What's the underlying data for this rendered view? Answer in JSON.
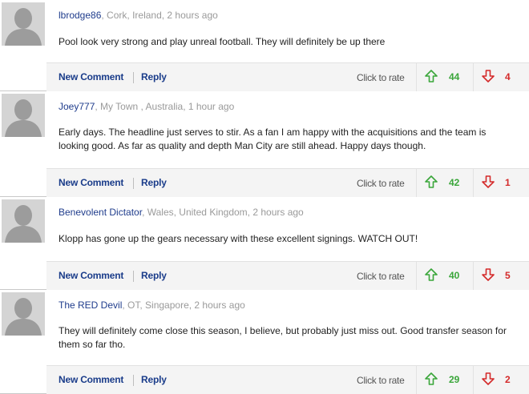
{
  "colors": {
    "author": "#1f3c8c",
    "location": "#9a9a9a",
    "action": "#1a3c8a",
    "up": "#3aa63a",
    "down": "#d42a2a",
    "action_bar_bg": "#f4f4f4"
  },
  "icons": {
    "avatar": "default-user-avatar-icon",
    "thumbs_up": "green-up-arrow-icon",
    "thumbs_down": "red-down-arrow-icon"
  },
  "labels": {
    "new_comment": "New Comment",
    "reply": "Reply",
    "click_to_rate": "Click to rate"
  },
  "comments": [
    {
      "author": "lbrodge86",
      "meta": ", Cork, Ireland, 2 hours ago",
      "body": "Pool look very strong and play unreal football. They will definitely be up there",
      "up": "44",
      "down": "4"
    },
    {
      "author": "Joey777",
      "meta": ", My Town , Australia, 1 hour ago",
      "body": "Early days. The headline just serves to stir. As a fan I am happy with the acquisitions and the team is looking good. As far as quality and depth Man City are still ahead. Happy days though.",
      "up": "42",
      "down": "1"
    },
    {
      "author": "Benevolent Dictator",
      "meta": ", Wales, United Kingdom, 2 hours ago",
      "body": "Klopp has gone up the gears necessary with these excellent signings. WATCH OUT!",
      "up": "40",
      "down": "5"
    },
    {
      "author": "The RED Devil",
      "meta": ", OT, Singapore, 2 hours ago",
      "body": "They will definitely come close this season, I believe, but probably just miss out. Good transfer season for them so far tho.",
      "up": "29",
      "down": "2"
    }
  ]
}
